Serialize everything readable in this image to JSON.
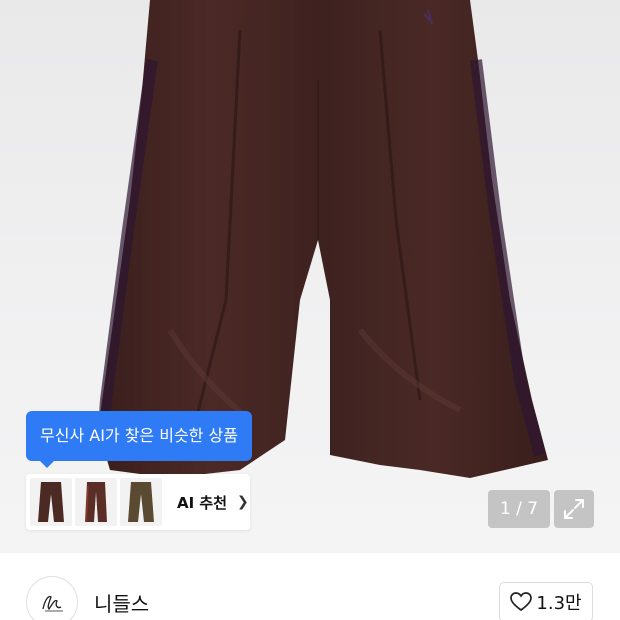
{
  "product": {
    "ai_tooltip": "무신사 AI가 찾은 비슷한 상품",
    "ai_recommend_label": "AI 추천",
    "image_counter": "1 / 7",
    "thumbnail_colors": [
      "#4a2a22",
      "#5a2e26",
      "#5b4a32"
    ]
  },
  "brand": {
    "name": "니들스",
    "like_count": "1.3만"
  },
  "icons": {
    "chevron": "chevron-right-icon",
    "expand": "expand-icon",
    "like": "heart-icon"
  }
}
